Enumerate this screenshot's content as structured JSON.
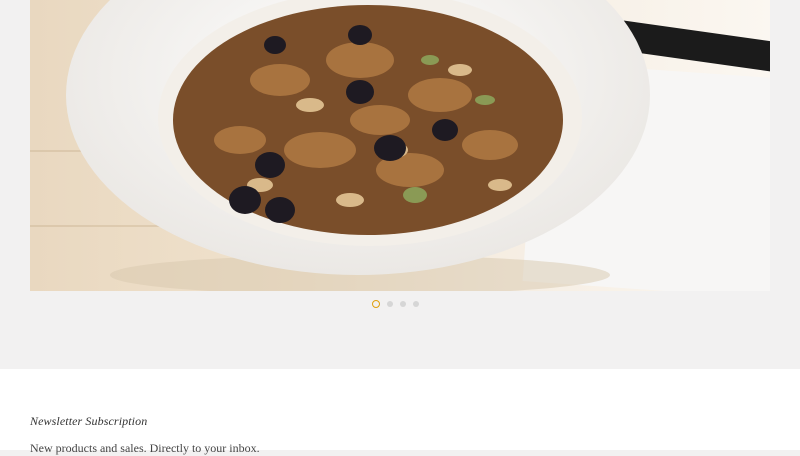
{
  "carousel": {
    "image_alt": "Bowl of granola with raisins and pumpkin seeds",
    "slides": [
      {
        "label": "Slide 1",
        "active": true
      },
      {
        "label": "Slide 2",
        "active": false
      },
      {
        "label": "Slide 3",
        "active": false
      },
      {
        "label": "Slide 4",
        "active": false
      }
    ],
    "accent_color": "#e0a10f"
  },
  "newsletter": {
    "title": "Newsletter Subscription",
    "subtitle": "New products and sales. Directly to your inbox."
  }
}
